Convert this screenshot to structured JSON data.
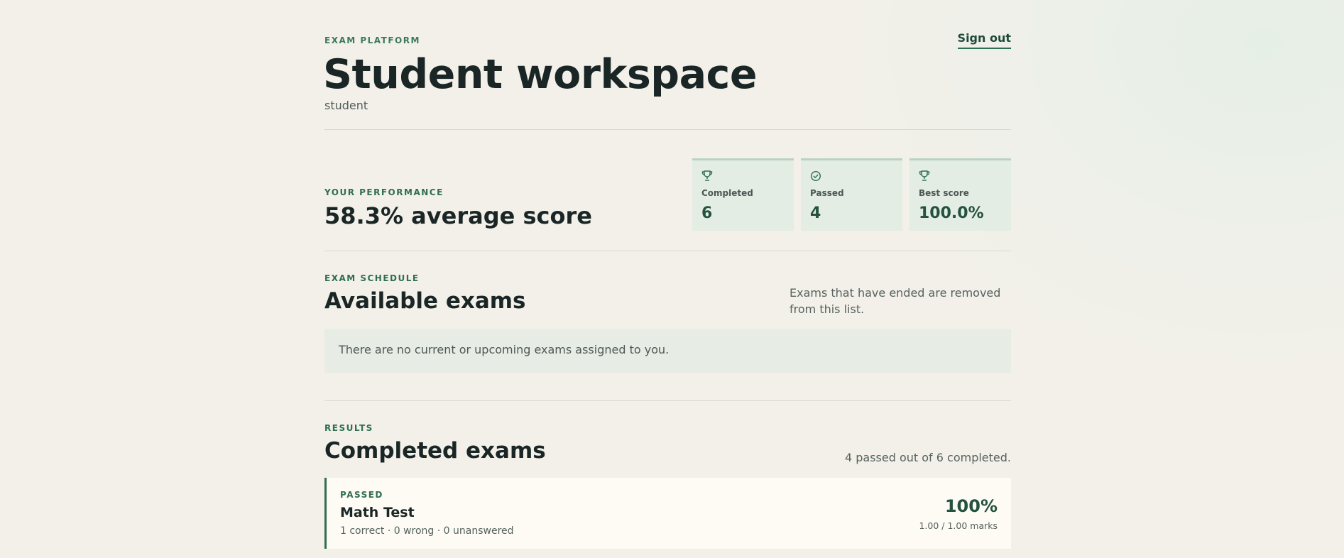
{
  "header": {
    "eyebrow": "EXAM PLATFORM",
    "title": "Student workspace",
    "username": "student",
    "sign_out_label": "Sign out"
  },
  "performance": {
    "eyebrow": "YOUR PERFORMANCE",
    "average": "58.3% average score",
    "stats": [
      {
        "icon": "trophy-icon",
        "label": "Completed",
        "value": "6"
      },
      {
        "icon": "check-circle-icon",
        "label": "Passed",
        "value": "4"
      },
      {
        "icon": "trophy-icon",
        "label": "Best score",
        "value": "100.0%"
      }
    ]
  },
  "schedule": {
    "eyebrow": "EXAM SCHEDULE",
    "title": "Available exams",
    "note": "Exams that have ended are removed from this list.",
    "empty_message": "There are no current or upcoming exams assigned to you."
  },
  "results": {
    "eyebrow": "RESULTS",
    "title": "Completed exams",
    "summary": "4 passed out of 6 completed.",
    "items": [
      {
        "status": "PASSED",
        "title": "Math Test",
        "meta": "1 correct · 0 wrong · 0 unanswered",
        "score": "100%",
        "marks": "1.00 / 1.00 marks"
      }
    ]
  },
  "colors": {
    "accent": "#2f6e52",
    "background": "#f3f0e9",
    "stat_card": "#e3ede3",
    "result_card": "#fdfbf3"
  }
}
